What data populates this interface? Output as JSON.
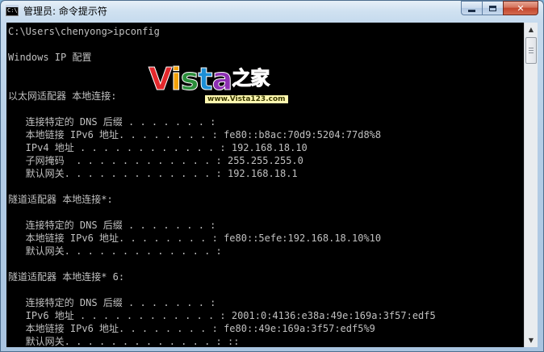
{
  "window": {
    "title": "管理员: 命令提示符",
    "icon": "cmd-window-icon",
    "icon_text": "C:\\",
    "controls": {
      "minimize": "minimize-icon",
      "maximize": "maximize-icon",
      "close": "close-icon",
      "close_glyph": "✕"
    }
  },
  "console": {
    "lines": [
      "C:\\Users\\chenyong>ipconfig",
      "",
      "Windows IP 配置",
      "",
      "",
      "以太网适配器 本地连接:",
      "",
      "   连接特定的 DNS 后缀 . . . . . . . :",
      "   本地链接 IPv6 地址. . . . . . . . : fe80::b8ac:70d9:5204:77d8%8",
      "   IPv4 地址 . . . . . . . . . . . . : 192.168.18.10",
      "   子网掩码  . . . . . . . . . . . . : 255.255.255.0",
      "   默认网关. . . . . . . . . . . . . : 192.168.18.1",
      "",
      "隧道适配器 本地连接*:",
      "",
      "   连接特定的 DNS 后缀 . . . . . . . :",
      "   本地链接 IPv6 地址. . . . . . . . : fe80::5efe:192.168.18.10%10",
      "   默认网关. . . . . . . . . . . . . :",
      "",
      "隧道适配器 本地连接* 6:",
      "",
      "   连接特定的 DNS 后缀 . . . . . . . :",
      "   IPv6 地址 . . . . . . . . . . . . : 2001:0:4136:e38a:49e:169a:3f57:edf5",
      "   本地链接 IPv6 地址. . . . . . . . : fe80::49e:169a:3f57:edf5%9",
      "   默认网关. . . . . . . . . . . . . : ::"
    ],
    "text_color": "#c0c0c0",
    "background": "#000000"
  },
  "watermark": {
    "logo_letters": [
      "V",
      "i",
      "s",
      "t",
      "a",
      "之家"
    ],
    "logo_colors": [
      "#e2282c",
      "#f3a20a",
      "#2a8d3a",
      "#1d8fd6",
      "#8d2fb3",
      "#d01f4f"
    ],
    "url": "www.Vista123.com"
  },
  "scrollbar": {
    "up": "scroll-up-arrow-icon",
    "down": "scroll-down-arrow-icon",
    "up_glyph": "▲",
    "down_glyph": "▼"
  }
}
